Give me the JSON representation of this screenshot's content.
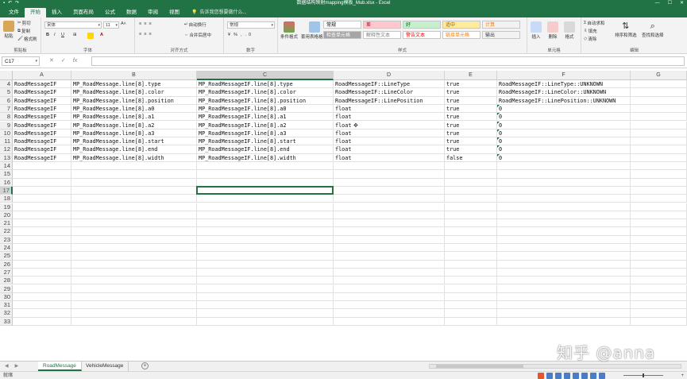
{
  "window": {
    "title": "数据结构映射mapping模板_Mub.xlsx - Excel",
    "minimize": "—",
    "maximize": "☐",
    "close": "✕"
  },
  "menu": {
    "tabs": [
      "文件",
      "开始",
      "插入",
      "页面布局",
      "公式",
      "数据",
      "审阅",
      "视图"
    ],
    "active_index": 1,
    "tell_me": "告诉我您想要做什么..."
  },
  "ribbon": {
    "clipboard": {
      "label": "剪贴板",
      "paste": "粘贴",
      "cut": "剪切",
      "copy": "复制",
      "format_painter": "格式刷"
    },
    "font": {
      "label": "字体",
      "font_name": "宋体",
      "font_size": "11"
    },
    "alignment": {
      "label": "对齐方式",
      "wrap": "自动换行",
      "merge": "合并后居中"
    },
    "number": {
      "label": "数字",
      "format": "常规"
    },
    "styles": {
      "label": "样式",
      "conditional": "条件格式",
      "table": "套用表格格式",
      "cells": [
        {
          "text": "常规",
          "bg": "#ffffff",
          "fg": "#000000"
        },
        {
          "text": "差",
          "bg": "#ffc7ce",
          "fg": "#9c0006"
        },
        {
          "text": "好",
          "bg": "#c6efce",
          "fg": "#006100"
        },
        {
          "text": "适中",
          "bg": "#ffeb9c",
          "fg": "#9c5700"
        },
        {
          "text": "计算",
          "bg": "#f2f2f2",
          "fg": "#fa7d00"
        },
        {
          "text": "检查单元格",
          "bg": "#a5a5a5",
          "fg": "#ffffff"
        },
        {
          "text": "解释性文本",
          "bg": "#ffffff",
          "fg": "#7f7f7f"
        },
        {
          "text": "警告文本",
          "bg": "#ffffff",
          "fg": "#ff0000"
        },
        {
          "text": "链接单元格",
          "bg": "#ffffff",
          "fg": "#fa7d00"
        },
        {
          "text": "输出",
          "bg": "#f2f2f2",
          "fg": "#3f3f3f"
        }
      ]
    },
    "cells_group": {
      "label": "单元格",
      "insert": "插入",
      "delete": "删除",
      "format": "格式"
    },
    "editing": {
      "label": "编辑",
      "autosum": "自动求和",
      "fill": "填充",
      "clear": "清除",
      "sort": "排序和筛选",
      "find": "查找和选择"
    }
  },
  "formula_bar": {
    "name_box": "C17",
    "fx": "fx",
    "cancel": "✕",
    "enter": "✓",
    "value": ""
  },
  "grid": {
    "columns": [
      "A",
      "B",
      "C",
      "D",
      "E",
      "F",
      "G"
    ],
    "selected_column": "C",
    "selected_row": "17",
    "row_numbers": [
      "4",
      "5",
      "6",
      "7",
      "8",
      "9",
      "10",
      "11",
      "12",
      "13",
      "14",
      "15",
      "16",
      "17",
      "18",
      "19",
      "20",
      "21",
      "22",
      "23",
      "24",
      "25",
      "26",
      "27",
      "28",
      "29",
      "30",
      "31",
      "32",
      "33"
    ],
    "rows": [
      [
        "RoadMessageIF",
        "MP_RoadMessage.line[8].type",
        "MP_RoadMessageIF.line[8].type",
        "RoadMessageIF::LineType",
        "true",
        "RoadMessageIF::LineType::UNKNOWN"
      ],
      [
        "RoadMessageIF",
        "MP_RoadMessage.line[8].color",
        "MP_RoadMessageIF.line[8].color",
        "RoadMessageIF::LineColor",
        "true",
        "RoadMessageIF::LineColor::UNKNOWN"
      ],
      [
        "RoadMessageIF",
        "MP_RoadMessage.line[8].position",
        "MP_RoadMessageIF.line[8].position",
        "RoadMessageIF::LinePosition",
        "true",
        "RoadMessageIF::LinePosition::UNKNOWN"
      ],
      [
        "RoadMessageIF",
        "MP_RoadMessage.line[8].a0",
        "MP_RoadMessageIF.line[8].a0",
        "float",
        "true",
        "0"
      ],
      [
        "RoadMessageIF",
        "MP_RoadMessage.line[8].a1",
        "MP_RoadMessageIF.line[8].a1",
        "float",
        "true",
        "0"
      ],
      [
        "RoadMessageIF",
        "MP_RoadMessage.line[8].a2",
        "MP_RoadMessageIF.line[8].a2",
        "float",
        "true",
        "0"
      ],
      [
        "RoadMessageIF",
        "MP_RoadMessage.line[8].a3",
        "MP_RoadMessageIF.line[8].a3",
        "float",
        "true",
        "0"
      ],
      [
        "RoadMessageIF",
        "MP_RoadMessage.line[8].start",
        "MP_RoadMessageIF.line[8].start",
        "float",
        "true",
        "0"
      ],
      [
        "RoadMessageIF",
        "MP_RoadMessage.line[8].end",
        "MP_RoadMessageIF.line[8].end",
        "float",
        "true",
        "0"
      ],
      [
        "RoadMessageIF",
        "MP_RoadMessage.line[8].width",
        "MP_RoadMessageIF.line[8].width",
        "float",
        "false",
        "0"
      ]
    ]
  },
  "sheets": {
    "tabs": [
      "RoadMessage",
      "VehicleMessage"
    ],
    "active_index": 0,
    "add": "+"
  },
  "status": {
    "text": "就绪"
  },
  "watermark": "知乎 @anna",
  "accent": "#217346"
}
